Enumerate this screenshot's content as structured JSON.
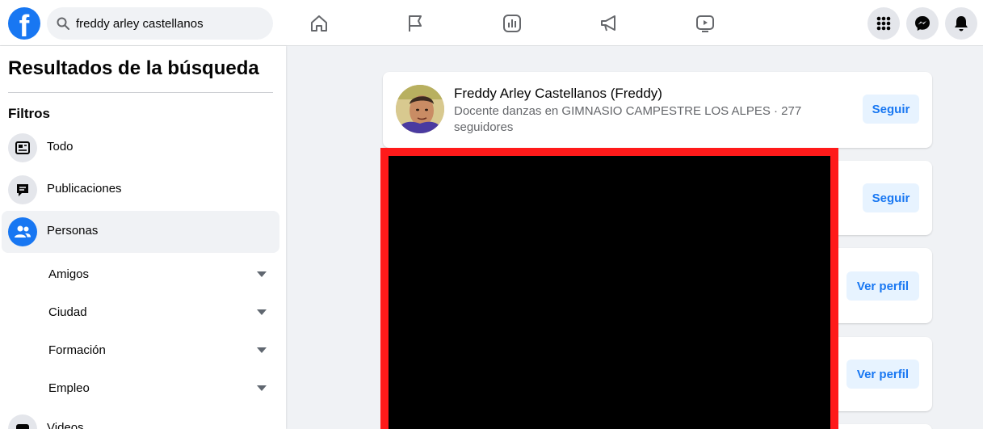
{
  "header": {
    "logo_letter": "f",
    "search_value": "freddy arley castellanos",
    "nav_icons": [
      "home-icon",
      "flag-icon",
      "chart-icon",
      "megaphone-icon",
      "video-icon"
    ],
    "right_buttons": [
      "menu-grid-icon",
      "messenger-icon",
      "notifications-icon"
    ]
  },
  "sidebar": {
    "title": "Resultados de la búsqueda",
    "filters_label": "Filtros",
    "items": [
      {
        "label": "Todo",
        "icon": "feed-icon"
      },
      {
        "label": "Publicaciones",
        "icon": "posts-icon"
      },
      {
        "label": "Personas",
        "icon": "people-icon",
        "active": true
      }
    ],
    "subfilters": [
      {
        "label": "Amigos"
      },
      {
        "label": "Ciudad"
      },
      {
        "label": "Formación"
      },
      {
        "label": "Empleo"
      }
    ],
    "next_item": {
      "label": "Videos",
      "icon": "video-icon"
    }
  },
  "results": [
    {
      "name": "Freddy Arley Castellanos (Freddy)",
      "description": "Docente danzas en GIMNASIO CAMPESTRE LOS ALPES · 277 seguidores",
      "button": "Seguir"
    },
    {
      "button": "Seguir"
    },
    {
      "button": "Ver perfil"
    },
    {
      "button": "Ver perfil"
    }
  ],
  "colors": {
    "brand": "#1877f2",
    "redaction_border": "#ff1a1a",
    "button_bg": "#e7f3ff"
  }
}
